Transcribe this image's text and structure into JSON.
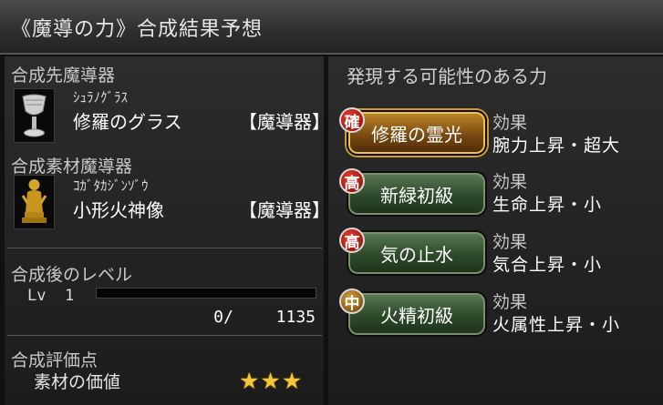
{
  "window": {
    "title": "《魔導の力》合成結果予想"
  },
  "target": {
    "section_label": "合成先魔導器",
    "icon": "goblet-icon",
    "kana": "ｼｭﾗﾉｸﾞﾗｽ",
    "name": "修羅のグラス",
    "type": "【魔導器】"
  },
  "material": {
    "section_label": "合成素材魔導器",
    "icon": "statue-icon",
    "kana": "ｺｶﾞﾀｶｼﾞﾝｿﾞｳ",
    "name": "小形火神像",
    "type": "【魔導器】"
  },
  "level": {
    "section_label": "合成後のレベル",
    "lv_text": "Lv  1",
    "exp_current": "0",
    "exp_slash": "/",
    "exp_max": "1135",
    "exp_fraction": 0
  },
  "evaluation": {
    "section_label": "合成評価点",
    "item_label": "素材の価値",
    "stars": "★★★",
    "star_count": 3
  },
  "powers": {
    "header": "発現する可能性のある力",
    "effect_label": "効果",
    "items": [
      {
        "badge": "確",
        "name": "修羅の霊光",
        "effect": "腕力上昇・超大",
        "selected": true
      },
      {
        "badge": "高",
        "name": "新緑初級",
        "effect": "生命上昇・小",
        "selected": false
      },
      {
        "badge": "高",
        "name": "気の止水",
        "effect": "気合上昇・小",
        "selected": false
      },
      {
        "badge": "中",
        "name": "火精初級",
        "effect": "火属性上昇・小",
        "selected": false
      }
    ]
  },
  "colors": {
    "accent_gold": "#f0c050",
    "badge_red": "#a01810",
    "button_green": "#2d4a2a"
  }
}
